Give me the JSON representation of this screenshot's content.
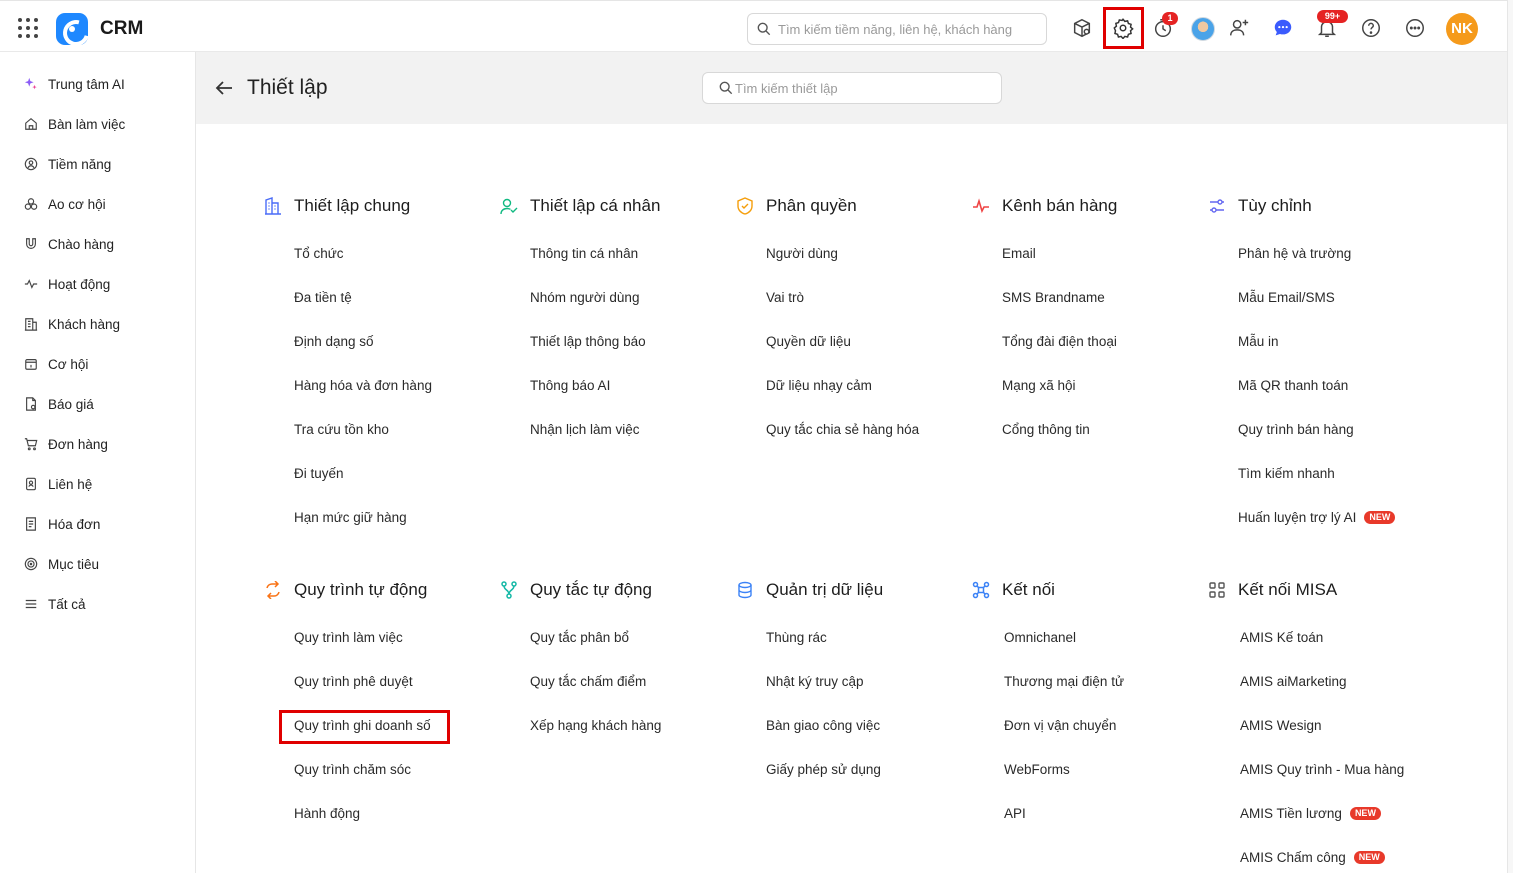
{
  "topbar": {
    "app_name": "CRM",
    "search_placeholder": "Tìm kiếm tiềm năng, liên hệ, khách hàng",
    "timer_badge": "1",
    "notification_badge": "99+",
    "user_initials": "NK"
  },
  "sidebar": {
    "items": [
      {
        "label": "Trung tâm AI",
        "icon": "ai-sparkle-icon"
      },
      {
        "label": "Bàn làm việc",
        "icon": "home-icon"
      },
      {
        "label": "Tiềm năng",
        "icon": "lead-icon"
      },
      {
        "label": "Ao cơ hội",
        "icon": "pool-icon"
      },
      {
        "label": "Chào hàng",
        "icon": "magnet-icon"
      },
      {
        "label": "Hoạt động",
        "icon": "activity-icon"
      },
      {
        "label": "Khách hàng",
        "icon": "building-icon"
      },
      {
        "label": "Cơ hội",
        "icon": "opportunity-icon"
      },
      {
        "label": "Báo giá",
        "icon": "quote-icon"
      },
      {
        "label": "Đơn hàng",
        "icon": "cart-icon"
      },
      {
        "label": "Liên hệ",
        "icon": "contact-icon"
      },
      {
        "label": "Hóa đơn",
        "icon": "invoice-icon"
      },
      {
        "label": "Mục tiêu",
        "icon": "target-icon"
      },
      {
        "label": "Tất cả",
        "icon": "menu-icon"
      }
    ]
  },
  "header": {
    "title": "Thiết lập",
    "search_placeholder": "Tìm kiếm thiết lập"
  },
  "sections": [
    {
      "title": "Thiết lập chung",
      "icon": "building-icon",
      "items": [
        "Tổ chức",
        "Đa tiền tệ",
        "Định dạng số",
        "Hàng hóa và đơn hàng",
        "Tra cứu tồn kho",
        "Đi tuyến",
        "Hạn mức giữ hàng"
      ]
    },
    {
      "title": "Thiết lập cá nhân",
      "icon": "user-check-icon",
      "items": [
        "Thông tin cá nhân",
        "Nhóm người dùng",
        "Thiết lập thông báo",
        "Thông báo AI",
        "Nhận lịch làm việc"
      ]
    },
    {
      "title": "Phân quyền",
      "icon": "shield-check-icon",
      "items": [
        "Người dùng",
        "Vai trò",
        "Quyền dữ liệu",
        "Dữ liệu nhạy cảm",
        "Quy tắc chia sẻ hàng hóa"
      ]
    },
    {
      "title": "Kênh bán hàng",
      "icon": "pulse-icon",
      "items": [
        "Email",
        "SMS Brandname",
        "Tổng đài điện thoại",
        "Mạng xã hội",
        "Cổng thông tin"
      ]
    },
    {
      "title": "Tùy chỉnh",
      "icon": "sliders-icon",
      "items": [
        "Phân hệ và trường",
        "Mẫu Email/SMS",
        "Mẫu in",
        "Mã QR thanh toán",
        "Quy trình bán hàng",
        "Tìm kiếm nhanh",
        "Huấn luyện trợ lý AI"
      ]
    },
    {
      "title": "Quy trình tự động",
      "icon": "repeat-icon",
      "items": [
        "Quy trình làm việc",
        "Quy trình phê duyệt",
        "Quy trình ghi doanh số",
        "Quy trình chăm sóc",
        "Hành động"
      ]
    },
    {
      "title": "Quy tắc tự động",
      "icon": "branch-icon",
      "items": [
        "Quy tắc phân bổ",
        "Quy tắc chấm điểm",
        "Xếp hạng khách hàng"
      ]
    },
    {
      "title": "Quản trị dữ liệu",
      "icon": "database-icon",
      "items": [
        "Thùng rác",
        "Nhật ký truy cập",
        "Bàn giao công việc",
        "Giấy phép sử dụng"
      ]
    },
    {
      "title": "Kết nối",
      "icon": "connect-icon",
      "items": [
        "Omnichanel",
        "Thương mại điện tử",
        "Đơn vị vận chuyển",
        "WebForms",
        "API"
      ]
    },
    {
      "title": "Kết nối MISA",
      "icon": "grid-icon",
      "items": [
        "AMIS Kế toán",
        "AMIS aiMarketing",
        "AMIS Wesign",
        "AMIS Quy trình - Mua hàng",
        "AMIS Tiền lương",
        "AMIS Chấm công"
      ]
    }
  ],
  "new_label": "NEW",
  "colors": {
    "accent": "#1e88ff",
    "highlight": "#e00000",
    "avatar": "#f59a1b",
    "badge": "#e52323"
  }
}
